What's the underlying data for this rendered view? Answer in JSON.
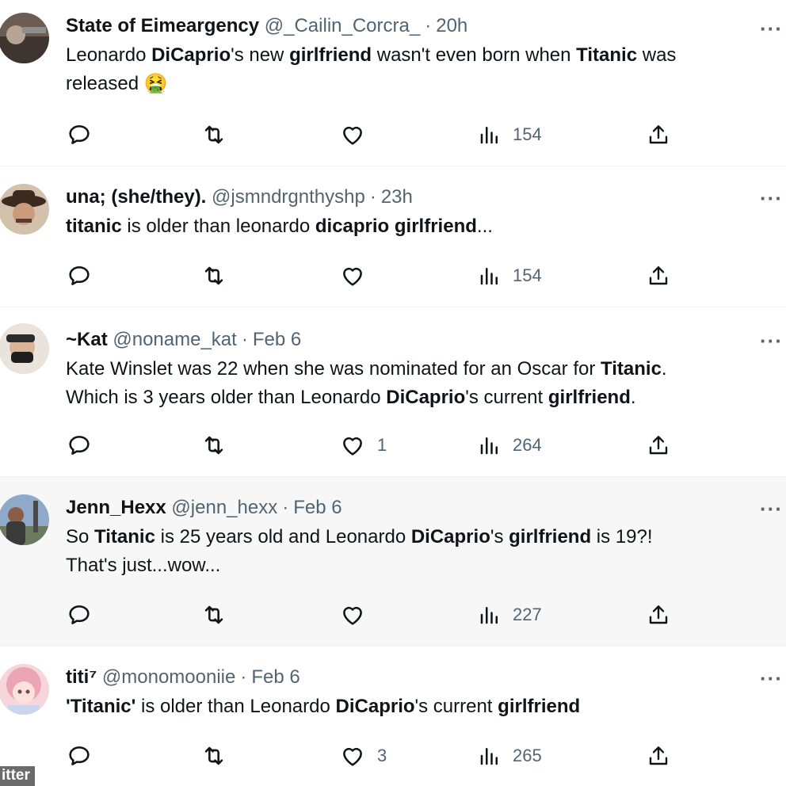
{
  "tweets": [
    {
      "display_name": "State of Eimeargency",
      "handle": "@_Cailin_Corcra_",
      "time": "20h",
      "text_parts": [
        "Leonardo ",
        "DiCaprio",
        "'s new ",
        "girlfriend",
        " wasn't even born when ",
        "Titanic",
        " was released "
      ],
      "emoji": "🤮",
      "likes": "",
      "views": "154",
      "avatar_colors": [
        "#5a4a42",
        "#8a7a6e"
      ]
    },
    {
      "display_name": "una; (she/they).",
      "handle": "@jsmndrgnthyshp",
      "time": "23h",
      "text_parts": [
        "titanic",
        " is older than leonardo ",
        "dicaprio",
        " ",
        "girlfriend",
        "..."
      ],
      "likes": "",
      "views": "154",
      "avatar_colors": [
        "#c9b7a4",
        "#3b2a20"
      ]
    },
    {
      "display_name": "~Kat",
      "handle": "@noname_kat",
      "time": "Feb 6",
      "text_parts": [
        "Kate Winslet was 22 when she was nominated for an Oscar for ",
        "Titanic",
        ".",
        "Which is 3 years older than Leonardo ",
        "DiCaprio",
        "'s current ",
        "girlfriend",
        "."
      ],
      "likes": "1",
      "views": "264",
      "avatar_colors": [
        "#e8412b",
        "#2b2b2b"
      ]
    },
    {
      "display_name": "Jenn_Hexx",
      "handle": "@jenn_hexx",
      "time": "Feb 6",
      "text_parts": [
        "So ",
        "Titanic",
        " is 25 years old and Leonardo ",
        "DiCaprio",
        "'s ",
        "girlfriend",
        " is 19?!",
        "That's just...wow..."
      ],
      "likes": "",
      "views": "227",
      "avatar_colors": [
        "#6f8fb5",
        "#3a3a3a"
      ]
    },
    {
      "display_name": "titi⁷",
      "handle": "@monomooniie",
      "time": "Feb 6",
      "text_parts": [
        "'Titanic'",
        " is older than Leonardo ",
        "DiCaprio",
        "'s current ",
        "girlfriend"
      ],
      "likes": "3",
      "views": "265",
      "avatar_colors": [
        "#f3c6cf",
        "#e89aa8"
      ]
    }
  ],
  "more_label": "···",
  "watermark": "itter",
  "icons": {
    "reply": "reply-icon",
    "retweet": "retweet-icon",
    "like": "heart-icon",
    "views": "views-icon",
    "share": "share-icon",
    "more": "more-icon"
  },
  "colors": {
    "text": "#0f1419",
    "muted": "#536471",
    "divider": "#eff3f4",
    "shaded_row": "#f7f7f7"
  }
}
